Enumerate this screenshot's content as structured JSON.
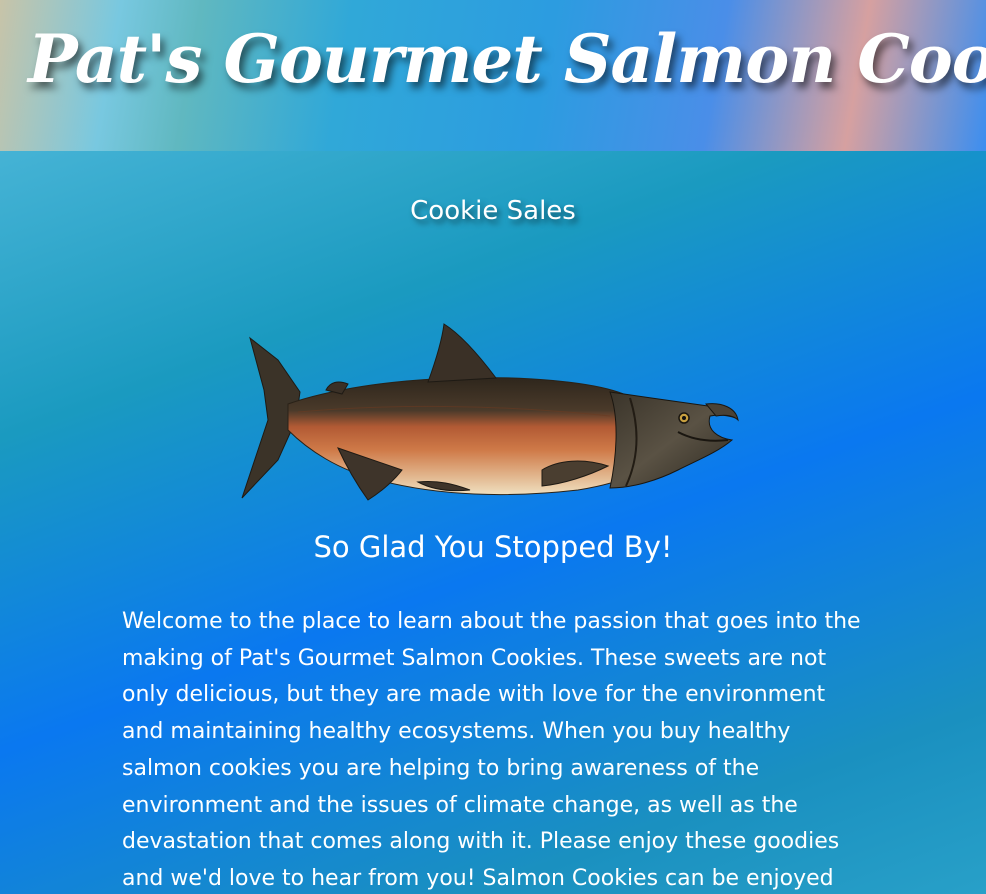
{
  "header": {
    "title": "Pat's Gourmet Salmon Cookies"
  },
  "nav": {
    "cookie_sales_link": "Cookie Sales"
  },
  "main": {
    "hero_image": "salmon-fish-illustration",
    "greeting": "So Glad You Stopped By!",
    "intro_text": "Welcome to the place to learn about the passion that goes into the making of Pat's Gourmet Salmon Cookies. These sweets are not only delicious, but they are made with love for the environment and maintaining healthy ecosystems. When you buy healthy salmon cookies you are helping to bring awareness of the environment and the issues of climate change, as well as the devastation that comes along with it. Please enjoy these goodies and we'd love to hear from you! Salmon Cookies can be enjoyed"
  },
  "colors": {
    "text": "#ffffff",
    "fish_back": "#3a2e22",
    "fish_belly": "#c0683a",
    "fish_head": "#4a4438"
  }
}
